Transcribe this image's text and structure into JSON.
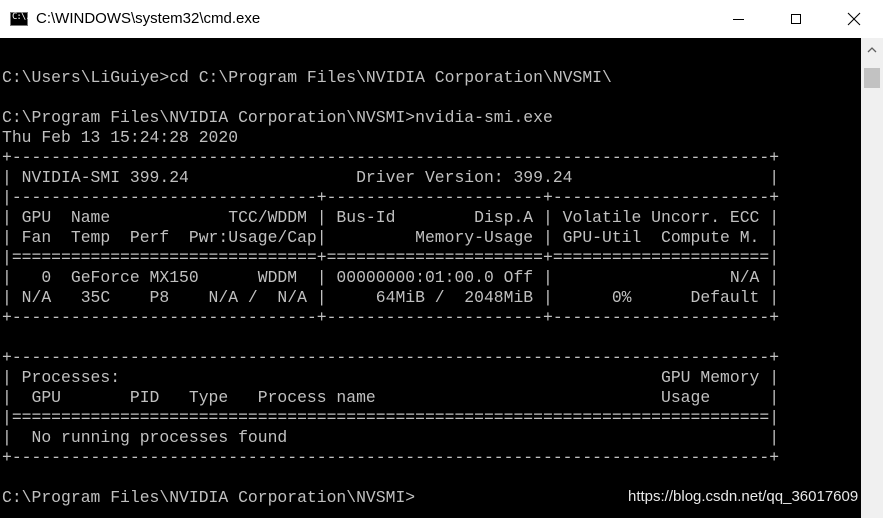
{
  "window": {
    "title": "C:\\WINDOWS\\system32\\cmd.exe",
    "icon": "cmd-app-icon",
    "icon_glyph": "C:\\."
  },
  "controls": {
    "minimize": "minimize-icon",
    "maximize": "maximize-icon",
    "close": "close-icon"
  },
  "console": {
    "lines": [
      "",
      "C:\\Users\\LiGuiye>cd C:\\Program Files\\NVIDIA Corporation\\NVSMI\\",
      "",
      "C:\\Program Files\\NVIDIA Corporation\\NVSMI>nvidia-smi.exe",
      "Thu Feb 13 15:24:28 2020",
      "+-----------------------------------------------------------------------------+",
      "| NVIDIA-SMI 399.24                 Driver Version: 399.24                    |",
      "|-------------------------------+----------------------+----------------------+",
      "| GPU  Name            TCC/WDDM | Bus-Id        Disp.A | Volatile Uncorr. ECC |",
      "| Fan  Temp  Perf  Pwr:Usage/Cap|         Memory-Usage | GPU-Util  Compute M. |",
      "|===============================+======================+======================|",
      "|   0  GeForce MX150      WDDM  | 00000000:01:00.0 Off |                  N/A |",
      "| N/A   35C    P8    N/A /  N/A |     64MiB /  2048MiB |      0%      Default |",
      "+-------------------------------+----------------------+----------------------+",
      "",
      "+-----------------------------------------------------------------------------+",
      "| Processes:                                                       GPU Memory |",
      "|  GPU       PID   Type   Process name                             Usage      |",
      "|=============================================================================|",
      "|  No running processes found                                                 |",
      "+-----------------------------------------------------------------------------+",
      "",
      "C:\\Program Files\\NVIDIA Corporation\\NVSMI>"
    ]
  },
  "scrollbar": {
    "up_arrow": "scroll-up-arrow-icon"
  },
  "watermark": "https://blog.csdn.net/qq_36017609"
}
